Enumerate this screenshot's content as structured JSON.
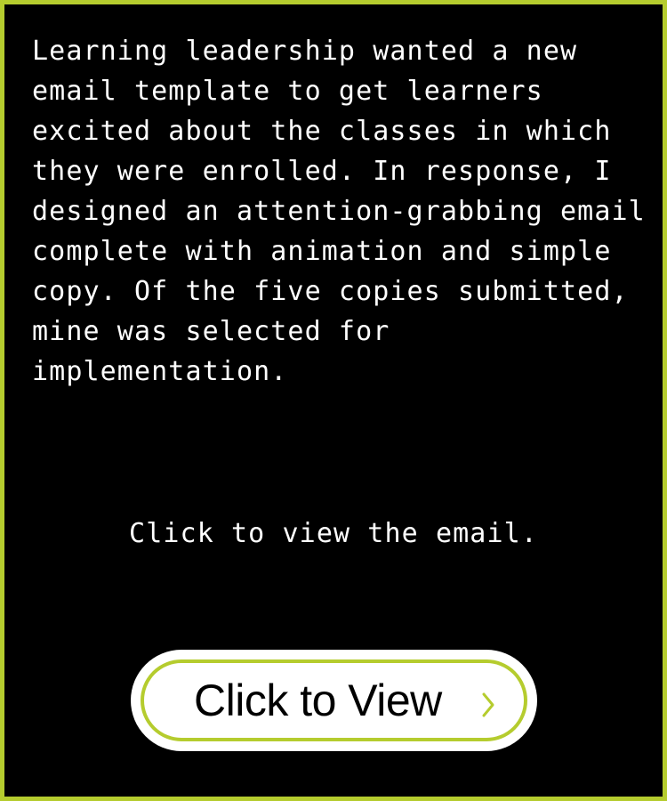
{
  "content": {
    "description": "Learning leadership wanted a new email template to get learners excited about the classes in which they were enrolled. In response, I designed an attention-grabbing email complete with animation and simple copy. Of the five copies submitted, mine was selected for implementation.",
    "cta_text": "Click to view the email."
  },
  "button": {
    "label": "Click to View",
    "icon": "chevron-right-icon"
  },
  "colors": {
    "background": "#000000",
    "accent": "#b5cc2e",
    "text": "#ffffff",
    "button_fill": "#ffffff",
    "button_text": "#000000"
  }
}
